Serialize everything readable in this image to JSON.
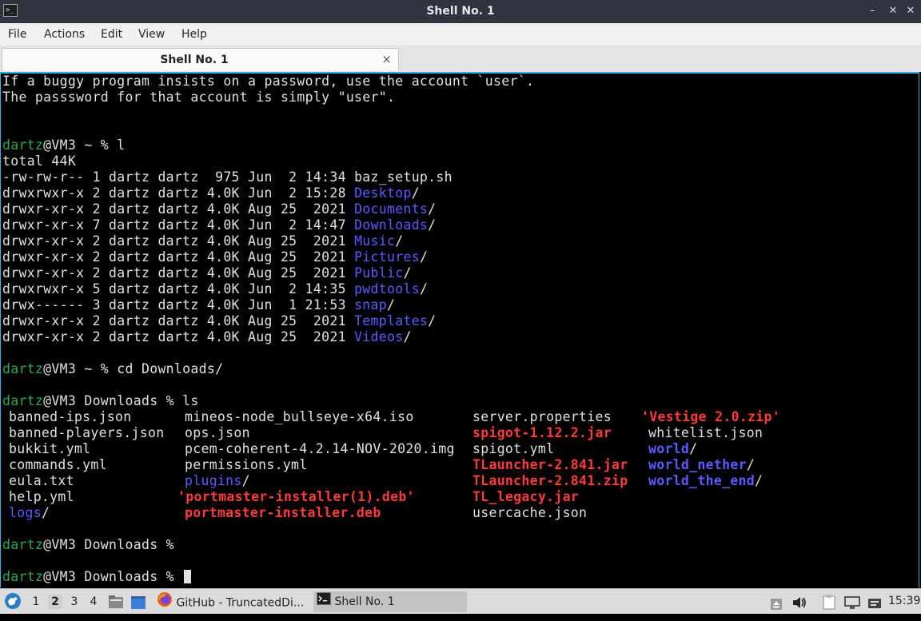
{
  "window": {
    "title": "Shell No. 1",
    "controls": [
      "minimize",
      "maximize",
      "close"
    ]
  },
  "menu": {
    "items": [
      "File",
      "Actions",
      "Edit",
      "View",
      "Help"
    ]
  },
  "tab": {
    "label": "Shell No. 1",
    "close_glyph": "×"
  },
  "terminal": {
    "motd": [
      "If a buggy program insists on a password, use the account `user`.",
      "The passsword for that account is simply \"user\"."
    ],
    "prompt_user": "dartz",
    "prompt1_rest": "@VM3 ~ % l",
    "total": "total 44K",
    "ls_l": [
      {
        "meta": "-rw-rw-r-- 1 dartz dartz  975 Jun  2 14:34 ",
        "name": "baz_setup.sh",
        "suffix": "",
        "dir": false
      },
      {
        "meta": "drwxrwxr-x 2 dartz dartz 4.0K Jun  2 15:28 ",
        "name": "Desktop",
        "suffix": "/",
        "dir": true
      },
      {
        "meta": "drwxr-xr-x 2 dartz dartz 4.0K Aug 25  2021 ",
        "name": "Documents",
        "suffix": "/",
        "dir": true
      },
      {
        "meta": "drwxr-xr-x 7 dartz dartz 4.0K Jun  2 14:47 ",
        "name": "Downloads",
        "suffix": "/",
        "dir": true
      },
      {
        "meta": "drwxr-xr-x 2 dartz dartz 4.0K Aug 25  2021 ",
        "name": "Music",
        "suffix": "/",
        "dir": true
      },
      {
        "meta": "drwxr-xr-x 2 dartz dartz 4.0K Aug 25  2021 ",
        "name": "Pictures",
        "suffix": "/",
        "dir": true
      },
      {
        "meta": "drwxr-xr-x 2 dartz dartz 4.0K Aug 25  2021 ",
        "name": "Public",
        "suffix": "/",
        "dir": true
      },
      {
        "meta": "drwxrwxr-x 5 dartz dartz 4.0K Jun  2 14:35 ",
        "name": "pwdtools",
        "suffix": "/",
        "dir": true
      },
      {
        "meta": "drwx------ 3 dartz dartz 4.0K Jun  1 21:53 ",
        "name": "snap",
        "suffix": "/",
        "dir": true
      },
      {
        "meta": "drwxr-xr-x 2 dartz dartz 4.0K Aug 25  2021 ",
        "name": "Templates",
        "suffix": "/",
        "dir": true
      },
      {
        "meta": "drwxr-xr-x 2 dartz dartz 4.0K Aug 25  2021 ",
        "name": "Videos",
        "suffix": "/",
        "dir": true
      }
    ],
    "prompt2_rest": "@VM3 ~ % cd Downloads/",
    "prompt3_rest": "@VM3 Downloads % ls",
    "ls_columns": [
      [
        {
          "t": "banned-ips.json",
          "k": "file"
        },
        {
          "t": "banned-players.json",
          "k": "file"
        },
        {
          "t": "bukkit.yml",
          "k": "file"
        },
        {
          "t": "commands.yml",
          "k": "file"
        },
        {
          "t": "eula.txt",
          "k": "file"
        },
        {
          "t": "help.yml",
          "k": "file"
        },
        {
          "t": "logs",
          "k": "dir"
        }
      ],
      [
        {
          "t": "mineos-node_bullseye-x64.iso",
          "k": "file"
        },
        {
          "t": "ops.json",
          "k": "file"
        },
        {
          "t": "pcem-coherent-4.2.14-NOV-2020.img",
          "k": "file"
        },
        {
          "t": "permissions.yml",
          "k": "file"
        },
        {
          "t": "plugins",
          "k": "dir"
        },
        {
          "t": "'portmaster-installer(1).deb'",
          "k": "archive"
        },
        {
          "t": "portmaster-installer.deb",
          "k": "archive"
        }
      ],
      [
        {
          "t": "server.properties",
          "k": "file"
        },
        {
          "t": "spigot-1.12.2.jar",
          "k": "archive"
        },
        {
          "t": "spigot.yml",
          "k": "file"
        },
        {
          "t": "TLauncher-2.841.jar",
          "k": "archive"
        },
        {
          "t": "TLauncher-2.841.zip",
          "k": "archive"
        },
        {
          "t": "TL_legacy.jar",
          "k": "archive"
        },
        {
          "t": "usercache.json",
          "k": "file"
        }
      ],
      [
        {
          "t": "'Vestige 2.0.zip'",
          "k": "archive"
        },
        {
          "t": "whitelist.json",
          "k": "file"
        },
        {
          "t": "world",
          "k": "dir"
        },
        {
          "t": "world_nether",
          "k": "dir"
        },
        {
          "t": "world_the_end",
          "k": "dir"
        }
      ]
    ],
    "prompt4_rest": "@VM3 Downloads %",
    "prompt5_rest": "@VM3 Downloads % "
  },
  "taskbar": {
    "workspaces": [
      "1",
      "2",
      "3",
      "4"
    ],
    "active_workspace": "2",
    "tasks": [
      {
        "label": "GitHub - TruncatedDi...",
        "icon": "firefox-icon"
      },
      {
        "label": "Shell No. 1",
        "icon": "terminal-icon"
      }
    ],
    "clock": "15:39"
  },
  "colors": {
    "prompt_user": "#2fa84f",
    "directory": "#5b5bff",
    "archive": "#ff3b3b",
    "accent_border": "#3daee9"
  }
}
